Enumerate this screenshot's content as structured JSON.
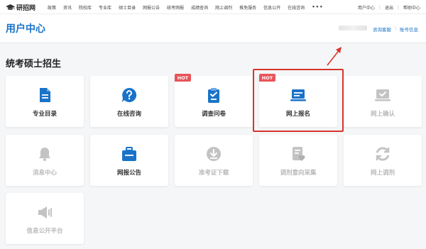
{
  "brand": {
    "name": "研招网"
  },
  "nav": {
    "items": [
      "政策",
      "资讯",
      "院校库",
      "专业库",
      "硕士目录",
      "网报公告",
      "统考网报",
      "成绩查询",
      "网上调剂",
      "推免服务",
      "信息公开",
      "在线咨询"
    ],
    "more": "•••"
  },
  "user_links": {
    "center": "用户中心",
    "logout": "退出",
    "help": "帮助中心",
    "sep": "|"
  },
  "header": {
    "title": "用户中心",
    "consult": "咨询客服",
    "account": "账号信息",
    "sep": "|"
  },
  "section": {
    "title": "统考硕士招生"
  },
  "hot_label": "HOT",
  "cards": [
    {
      "label": "专业目录",
      "icon": "document-icon",
      "enabled": true
    },
    {
      "label": "在线咨询",
      "icon": "chat-question-icon",
      "enabled": true
    },
    {
      "label": "调查问卷",
      "icon": "clipboard-check-icon",
      "enabled": true,
      "hot": true
    },
    {
      "label": "网上报名",
      "icon": "laptop-icon",
      "enabled": true,
      "hot": true,
      "highlighted": true
    },
    {
      "label": "网上确认",
      "icon": "laptop-check-icon",
      "enabled": false
    },
    {
      "label": "消息中心",
      "icon": "bell-icon",
      "enabled": false
    },
    {
      "label": "网报公告",
      "icon": "briefcase-icon",
      "enabled": true
    },
    {
      "label": "准考证下载",
      "icon": "download-icon",
      "enabled": false
    },
    {
      "label": "调剂意向采集",
      "icon": "form-heart-icon",
      "enabled": false
    },
    {
      "label": "网上调剂",
      "icon": "refresh-icon",
      "enabled": false
    },
    {
      "label": "信息公开平台",
      "icon": "megaphone-icon",
      "enabled": false
    }
  ],
  "colors": {
    "accent": "#1a73c8",
    "hot": "#e8545a",
    "disabled": "#c3c3c3",
    "highlight": "#d9342b"
  }
}
